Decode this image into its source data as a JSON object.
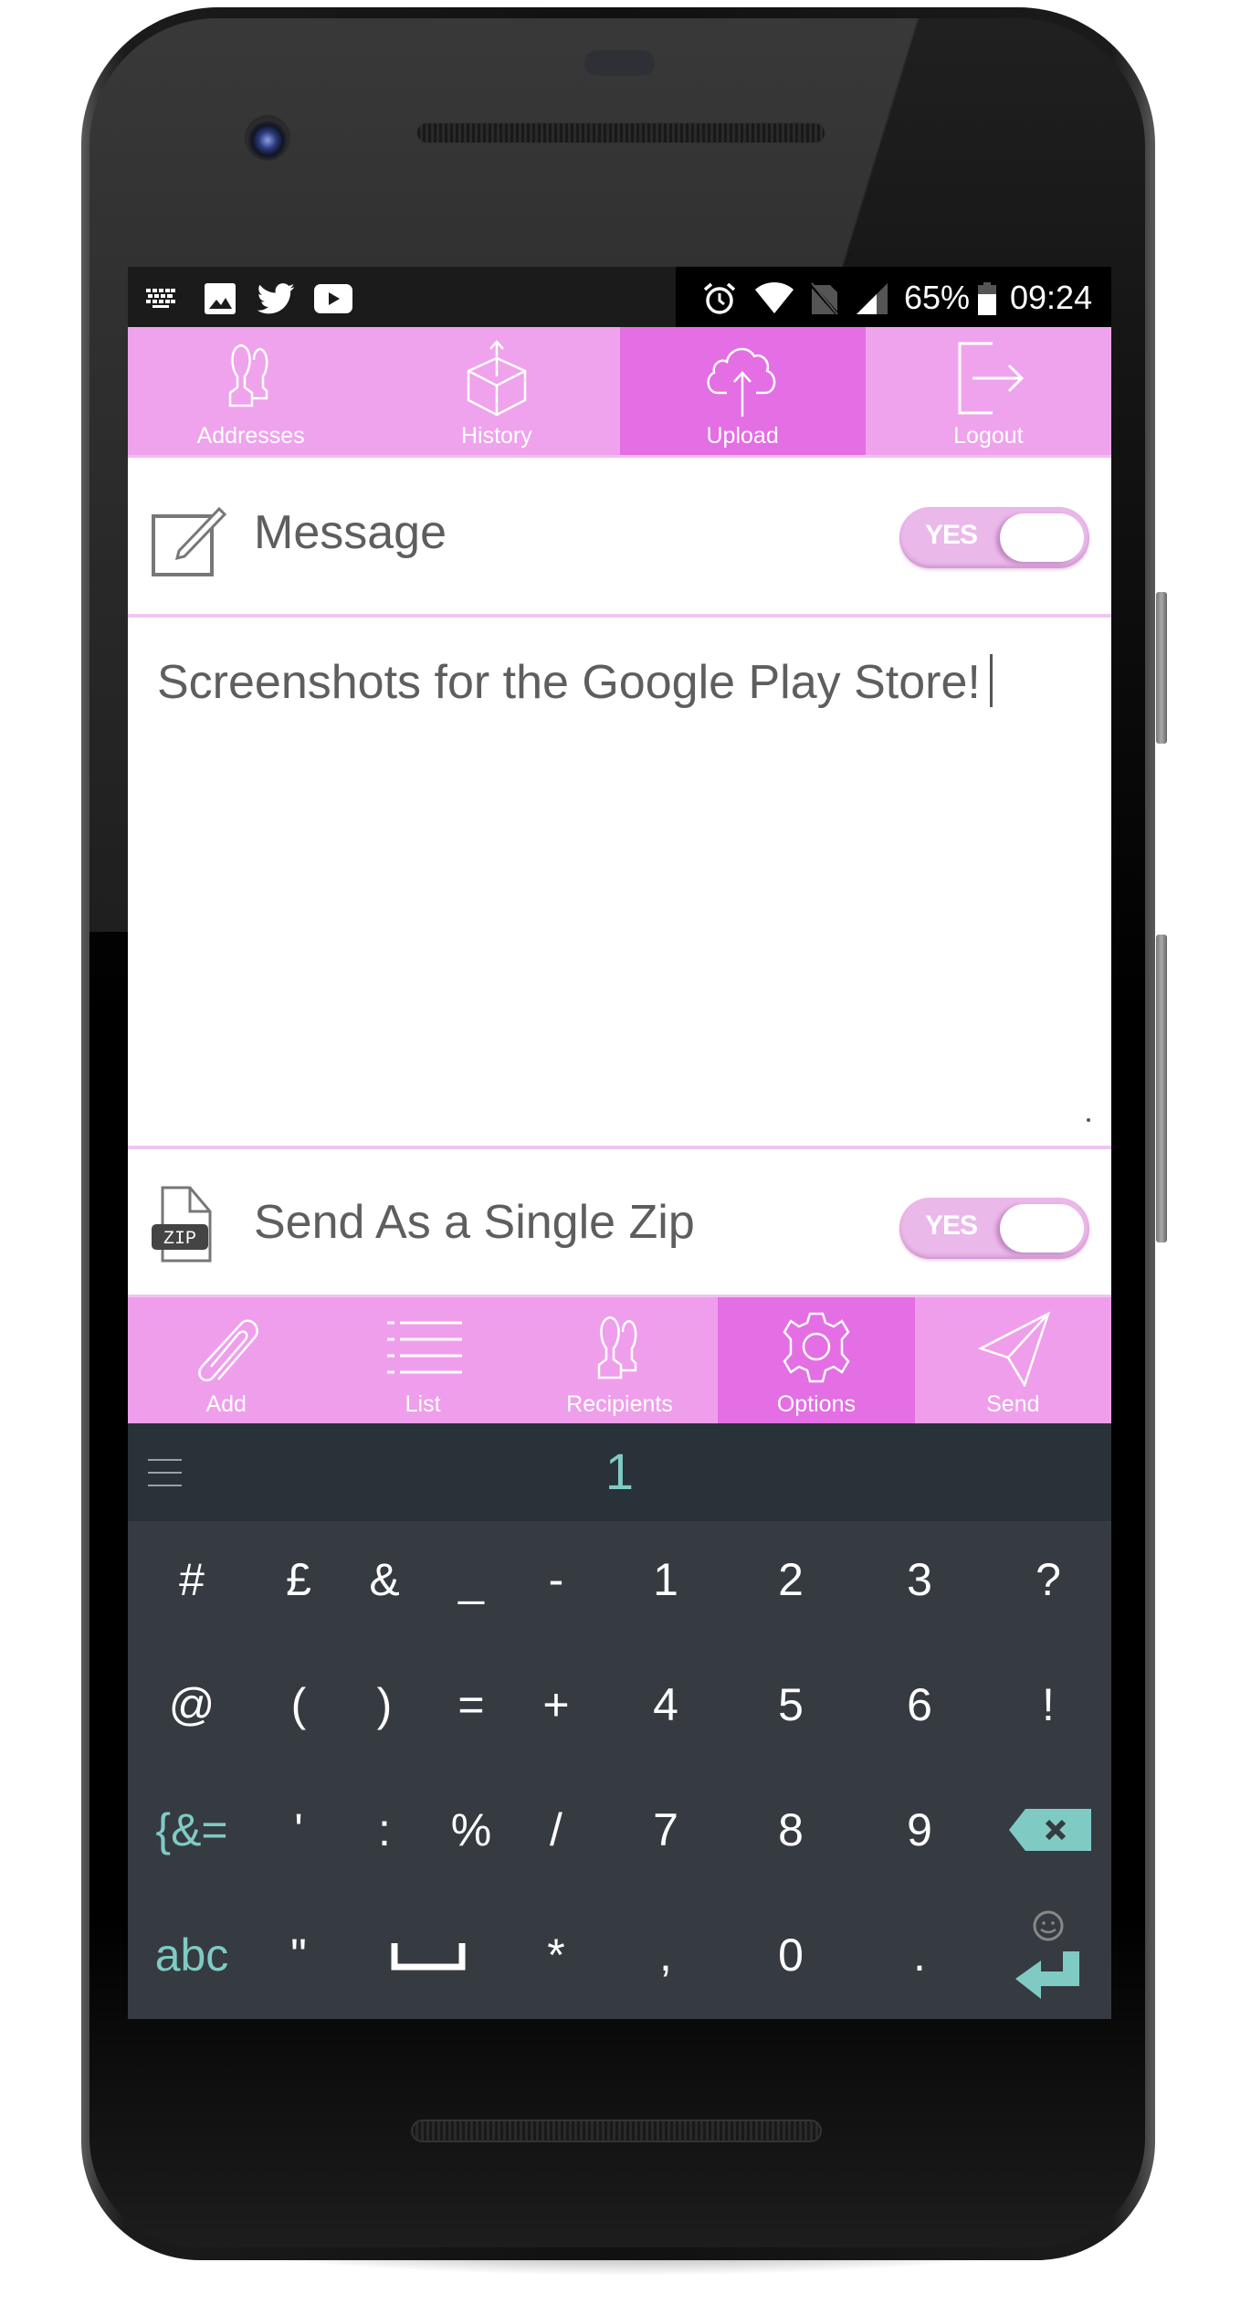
{
  "status_bar": {
    "left_icons": [
      "keyboard-icon",
      "image-icon",
      "twitter-icon",
      "youtube-icon"
    ],
    "right_icons": [
      "alarm-icon",
      "wifi-icon",
      "no-sim-icon",
      "signal-icon"
    ],
    "battery_percent": "65%",
    "battery_icon": "battery-icon",
    "time": "09:24"
  },
  "top_nav": {
    "items": [
      {
        "label": "Addresses",
        "icon": "contacts-icon",
        "active": false
      },
      {
        "label": "History",
        "icon": "box-icon",
        "active": false
      },
      {
        "label": "Upload",
        "icon": "cloud-upload-icon",
        "active": true
      },
      {
        "label": "Logout",
        "icon": "logout-icon",
        "active": false
      }
    ]
  },
  "message_row": {
    "icon": "edit-icon",
    "label": "Message",
    "toggle_label": "YES",
    "toggle_on": true
  },
  "message_text": {
    "value": "Screenshots for the Google Play Store!"
  },
  "zip_row": {
    "icon": "zip-file-icon",
    "icon_text": "ZIP",
    "label": "Send As a Single Zip",
    "toggle_label": "YES",
    "toggle_on": true
  },
  "bottom_nav": {
    "items": [
      {
        "label": "Add",
        "icon": "paperclip-icon",
        "active": false
      },
      {
        "label": "List",
        "icon": "list-icon",
        "active": false
      },
      {
        "label": "Recipients",
        "icon": "recipients-icon",
        "active": false
      },
      {
        "label": "Options",
        "icon": "gear-icon",
        "active": true
      },
      {
        "label": "Send",
        "icon": "send-icon",
        "active": false
      }
    ]
  },
  "keyboard": {
    "suggestion": "1",
    "rows": [
      [
        "#",
        "£",
        "&",
        "_",
        "-",
        "1",
        "2",
        "3",
        "?"
      ],
      [
        "@",
        "(",
        ")",
        "=",
        "+",
        "4",
        "5",
        "6",
        "!"
      ],
      [
        "{&=",
        "'",
        ":",
        "%",
        "/",
        "7",
        "8",
        "9",
        "⌫"
      ],
      [
        "abc",
        "\"",
        "␣",
        "*",
        ",",
        "0",
        ".",
        "↵"
      ]
    ]
  },
  "colors": {
    "nav_pink": "#EFA3EC",
    "nav_active": "#E46EE4",
    "toggle_pink": "#EBB8EA",
    "keyboard_bg": "#353B41",
    "keyboard_accent": "#7FCBC4",
    "text_gray": "#5E5E5E"
  }
}
